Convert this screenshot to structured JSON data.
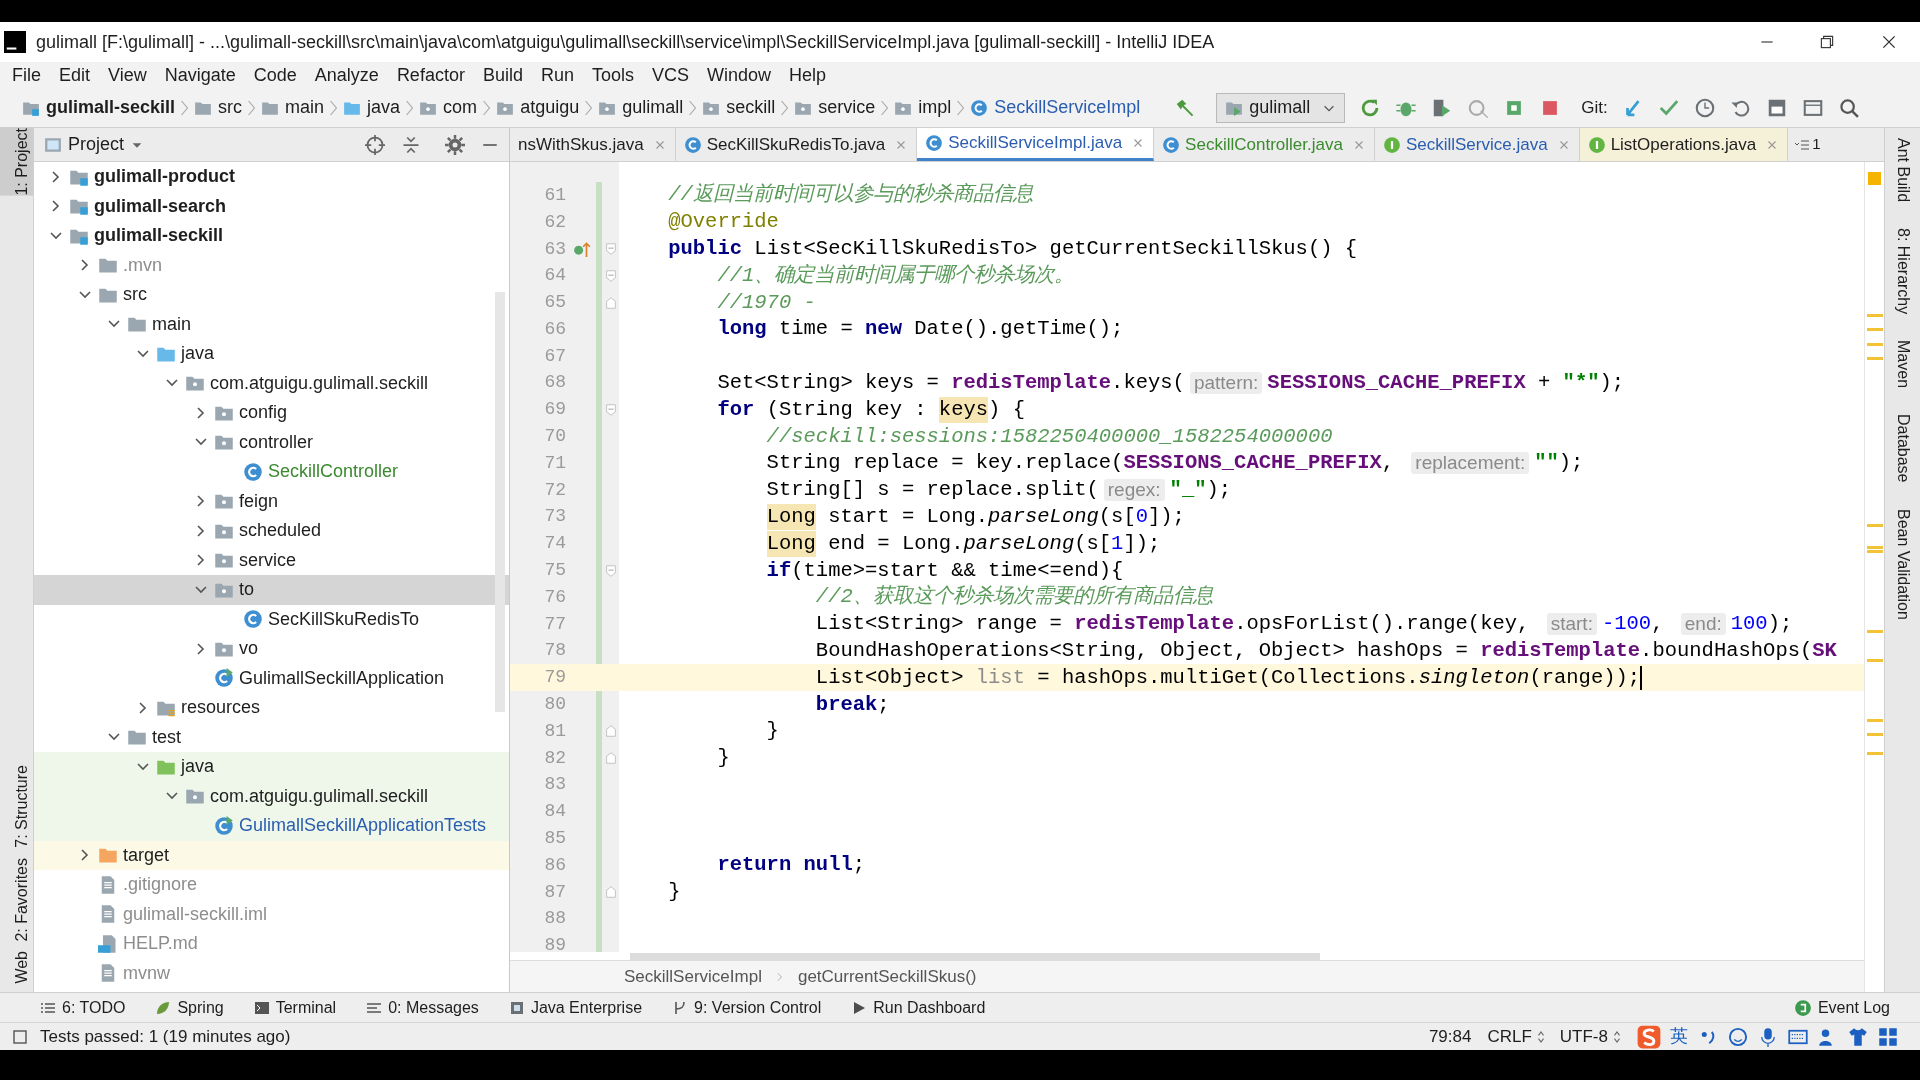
{
  "window": {
    "title": "gulimall [F:\\gulimall] - ...\\gulimall-seckill\\src\\main\\java\\com\\atguigu\\gulimall\\seckill\\service\\impl\\SeckillServiceImpl.java [gulimall-seckill] - IntelliJ IDEA"
  },
  "menu": [
    "File",
    "Edit",
    "View",
    "Navigate",
    "Code",
    "Analyze",
    "Refactor",
    "Build",
    "Run",
    "Tools",
    "VCS",
    "Window",
    "Help"
  ],
  "navigation_bar": {
    "items": [
      {
        "label": "gulimall-seckill",
        "kind": "module"
      },
      {
        "label": "src",
        "kind": "folder"
      },
      {
        "label": "main",
        "kind": "folder"
      },
      {
        "label": "java",
        "kind": "source_folder"
      },
      {
        "label": "com",
        "kind": "package"
      },
      {
        "label": "atguigu",
        "kind": "package"
      },
      {
        "label": "gulimall",
        "kind": "package"
      },
      {
        "label": "seckill",
        "kind": "package"
      },
      {
        "label": "service",
        "kind": "package"
      },
      {
        "label": "impl",
        "kind": "package"
      },
      {
        "label": "SeckillServiceImpl",
        "kind": "class"
      }
    ],
    "run_config": "gulimall",
    "vcs_label": "Git:"
  },
  "left_tool_strip": [
    {
      "label": "1: Project",
      "selected": true
    },
    {
      "label": "7: Structure",
      "selected": false
    },
    {
      "label": "2: Favorites",
      "selected": false
    },
    {
      "label": "Web",
      "selected": false
    }
  ],
  "project_panel": {
    "title": "Project",
    "tree": [
      {
        "label": "gulimall-product",
        "kind": "module",
        "expanded": false,
        "selected": false
      },
      {
        "label": "gulimall-search",
        "kind": "module",
        "expanded": false,
        "selected": false
      },
      {
        "label": "gulimall-seckill",
        "kind": "module",
        "expanded": true,
        "selected": false,
        "children": [
          {
            "label": ".mvn",
            "kind": "folder",
            "expanded": false,
            "selected": false,
            "color": "#8d8d8d"
          },
          {
            "label": "src",
            "kind": "folder",
            "expanded": true,
            "selected": false,
            "children": [
              {
                "label": "main",
                "kind": "folder",
                "expanded": true,
                "selected": false,
                "children": [
                  {
                    "label": "java",
                    "kind": "source_folder",
                    "expanded": true,
                    "selected": false,
                    "children": [
                      {
                        "label": "com.atguigu.gulimall.seckill",
                        "kind": "package",
                        "expanded": true,
                        "selected": false,
                        "children": [
                          {
                            "label": "config",
                            "kind": "package",
                            "expanded": false,
                            "selected": false
                          },
                          {
                            "label": "controller",
                            "kind": "package",
                            "expanded": true,
                            "selected": false,
                            "children": [
                              {
                                "label": "SeckillController",
                                "kind": "class",
                                "selected": false,
                                "color": "#3a8a2e"
                              }
                            ]
                          },
                          {
                            "label": "feign",
                            "kind": "package",
                            "expanded": false,
                            "selected": false
                          },
                          {
                            "label": "scheduled",
                            "kind": "package",
                            "expanded": false,
                            "selected": false
                          },
                          {
                            "label": "service",
                            "kind": "package",
                            "expanded": false,
                            "selected": false
                          },
                          {
                            "label": "to",
                            "kind": "package",
                            "expanded": true,
                            "selected": true,
                            "children": [
                              {
                                "label": "SecKillSkuRedisTo",
                                "kind": "class",
                                "selected": false
                              }
                            ]
                          },
                          {
                            "label": "vo",
                            "kind": "package",
                            "expanded": false,
                            "selected": false
                          },
                          {
                            "label": "GulimallSeckillApplication",
                            "kind": "run_class",
                            "selected": false
                          }
                        ]
                      }
                    ]
                  },
                  {
                    "label": "resources",
                    "kind": "resource_folder",
                    "expanded": false,
                    "selected": false
                  }
                ]
              },
              {
                "label": "test",
                "kind": "folder",
                "expanded": true,
                "selected": false,
                "children": [
                  {
                    "label": "java",
                    "kind": "test_folder",
                    "expanded": true,
                    "selected": false,
                    "children": [
                      {
                        "label": "com.atguigu.gulimall.seckill",
                        "kind": "package",
                        "expanded": true,
                        "selected": false,
                        "children": [
                          {
                            "label": "GulimallSeckillApplicationTests",
                            "kind": "run_class",
                            "selected": false,
                            "color": "#2a5db0"
                          }
                        ]
                      }
                    ]
                  }
                ]
              }
            ]
          },
          {
            "label": "target",
            "kind": "excluded_folder",
            "expanded": false,
            "selected": false
          },
          {
            "label": ".gitignore",
            "kind": "file",
            "selected": false,
            "color": "#8d8d8d"
          },
          {
            "label": "gulimall-seckill.iml",
            "kind": "file",
            "selected": false,
            "color": "#8d8d8d"
          },
          {
            "label": "HELP.md",
            "kind": "markdown",
            "selected": false,
            "color": "#8d8d8d"
          },
          {
            "label": "mvnw",
            "kind": "file",
            "selected": false,
            "color": "#8d8d8d"
          }
        ]
      }
    ]
  },
  "editor_tabs": [
    {
      "label": "nsWithSkus.java",
      "selected": false,
      "library": false
    },
    {
      "label": "SecKillSkuRedisTo.java",
      "selected": false,
      "library": false
    },
    {
      "label": "SeckillServiceImpl.java",
      "selected": true,
      "library": false,
      "color": "#2a5db0"
    },
    {
      "label": "SeckillController.java",
      "selected": false,
      "library": false,
      "color": "#3a8a2e"
    },
    {
      "label": "SeckillService.java",
      "selected": false,
      "library": false,
      "color": "#2a5db0"
    },
    {
      "label": "ListOperations.java",
      "selected": false,
      "library": true
    }
  ],
  "hidden_tab_count": "1",
  "editor": {
    "lines": [
      {
        "number": "61",
        "tokens": [
          {
            "kind": "comment",
            "text": "    //返回当前时间可以参与的秒杀商品信息"
          }
        ]
      },
      {
        "number": "62",
        "tokens": [
          {
            "kind": "annotation",
            "text": "    @Override"
          }
        ]
      },
      {
        "number": "63",
        "implemented": true,
        "fold_start": true,
        "tokens": [
          {
            "kind": "keyword",
            "text": "    public"
          },
          {
            "kind": "text",
            "text": " List<SecKillSkuRedisTo> getCurrentSeckillSkus() {"
          }
        ]
      },
      {
        "number": "64",
        "fold_start": true,
        "tokens": [
          {
            "kind": "comment",
            "text": "        //1、确定当前时间属于哪个秒杀场次。"
          }
        ]
      },
      {
        "number": "65",
        "fold_end": true,
        "tokens": [
          {
            "kind": "comment",
            "text": "        //1970 -"
          }
        ]
      },
      {
        "number": "66",
        "tokens": [
          {
            "kind": "keyword",
            "text": "        long"
          },
          {
            "kind": "text",
            "text": " time = "
          },
          {
            "kind": "keyword",
            "text": "new"
          },
          {
            "kind": "text",
            "text": " Date().getTime();"
          }
        ]
      },
      {
        "number": "67"
      },
      {
        "number": "68",
        "tokens": [
          {
            "kind": "text",
            "text": "        Set<String> keys = "
          },
          {
            "kind": "field",
            "text": "redisTemplate"
          },
          {
            "kind": "text",
            "text": ".keys("
          },
          {
            "kind": "hint",
            "text": "pattern:"
          },
          {
            "kind": "field",
            "text": "SESSIONS_CACHE_PREFIX"
          },
          {
            "kind": "text",
            "text": " + "
          },
          {
            "kind": "string",
            "text": "\"*\""
          },
          {
            "kind": "text",
            "text": ");"
          }
        ]
      },
      {
        "number": "69",
        "fold_start": true,
        "tokens": [
          {
            "kind": "keyword",
            "text": "        for"
          },
          {
            "kind": "text",
            "text": " (String key : "
          },
          {
            "kind": "match",
            "text": "keys"
          },
          {
            "kind": "text",
            "text": ") {"
          }
        ]
      },
      {
        "number": "70",
        "tokens": [
          {
            "kind": "comment",
            "text": "            //seckill:sessions:1582250400000_1582254000000"
          }
        ]
      },
      {
        "number": "71",
        "tokens": [
          {
            "kind": "text",
            "text": "            String replace = key.replace("
          },
          {
            "kind": "field",
            "text": "SESSIONS_CACHE_PREFIX"
          },
          {
            "kind": "text",
            "text": ", "
          },
          {
            "kind": "hint",
            "text": "replacement:"
          },
          {
            "kind": "string",
            "text": "\"\""
          },
          {
            "kind": "text",
            "text": ");"
          }
        ]
      },
      {
        "number": "72",
        "tokens": [
          {
            "kind": "text",
            "text": "            String[] s = replace.split("
          },
          {
            "kind": "hint",
            "text": "regex:"
          },
          {
            "kind": "string",
            "text": "\"_\""
          },
          {
            "kind": "text",
            "text": ");"
          }
        ]
      },
      {
        "number": "73",
        "tokens": [
          {
            "kind": "match",
            "text": "            Long"
          },
          {
            "kind": "text",
            "text": " start = Long."
          },
          {
            "kind": "static_call",
            "text": "parseLong"
          },
          {
            "kind": "text",
            "text": "(s["
          },
          {
            "kind": "number",
            "text": "0"
          },
          {
            "kind": "text",
            "text": "]);"
          }
        ]
      },
      {
        "number": "74",
        "tokens": [
          {
            "kind": "match",
            "text": "            Long"
          },
          {
            "kind": "text",
            "text": " end = Long."
          },
          {
            "kind": "static_call",
            "text": "parseLong"
          },
          {
            "kind": "text",
            "text": "(s["
          },
          {
            "kind": "number",
            "text": "1"
          },
          {
            "kind": "text",
            "text": "]);"
          }
        ]
      },
      {
        "number": "75",
        "fold_start": true,
        "tokens": [
          {
            "kind": "keyword",
            "text": "            if"
          },
          {
            "kind": "text",
            "text": "(time>=start && time<=end){"
          }
        ]
      },
      {
        "number": "76",
        "tokens": [
          {
            "kind": "comment",
            "text": "                //2、获取这个秒杀场次需要的所有商品信息"
          }
        ]
      },
      {
        "number": "77",
        "tokens": [
          {
            "kind": "text",
            "text": "                List<String> range = "
          },
          {
            "kind": "field",
            "text": "redisTemplate"
          },
          {
            "kind": "text",
            "text": ".opsForList().range(key, "
          },
          {
            "kind": "hint",
            "text": "start:"
          },
          {
            "kind": "number",
            "text": "-100"
          },
          {
            "kind": "text",
            "text": ", "
          },
          {
            "kind": "hint",
            "text": "end:"
          },
          {
            "kind": "number",
            "text": "100"
          },
          {
            "kind": "text",
            "text": ");"
          }
        ]
      },
      {
        "number": "78",
        "tokens": [
          {
            "kind": "text",
            "text": "                BoundHashOperations<String, Object, Object> hashOps = "
          },
          {
            "kind": "field",
            "text": "redisTemplate"
          },
          {
            "kind": "text",
            "text": ".boundHashOps("
          },
          {
            "kind": "field",
            "text": "SK"
          }
        ]
      },
      {
        "number": "79",
        "current": true,
        "tokens": [
          {
            "kind": "text",
            "text": "                List<Object> "
          },
          {
            "kind": "unused",
            "text": "list"
          },
          {
            "kind": "text",
            "text": " = hashOps.multiGet(Collections."
          },
          {
            "kind": "static_call",
            "text": "singleton"
          },
          {
            "kind": "text",
            "text": "(range));"
          }
        ]
      },
      {
        "number": "80",
        "tokens": [
          {
            "kind": "keyword",
            "text": "                break"
          },
          {
            "kind": "text",
            "text": ";"
          }
        ]
      },
      {
        "number": "81",
        "fold_end": true,
        "tokens": [
          {
            "kind": "text",
            "text": "            }"
          }
        ]
      },
      {
        "number": "82",
        "fold_end": true,
        "tokens": [
          {
            "kind": "text",
            "text": "        }"
          }
        ]
      },
      {
        "number": "83"
      },
      {
        "number": "84"
      },
      {
        "number": "85"
      },
      {
        "number": "86",
        "tokens": [
          {
            "kind": "keyword",
            "text": "        return"
          },
          {
            "kind": "keyword",
            "text": " null"
          },
          {
            "kind": "text",
            "text": ";"
          }
        ]
      },
      {
        "number": "87",
        "fold_end": true,
        "tokens": [
          {
            "kind": "text",
            "text": "    }"
          }
        ]
      },
      {
        "number": "88"
      },
      {
        "number": "89"
      }
    ],
    "breadcrumb": [
      "SeckillServiceImpl",
      "getCurrentSeckillSkus()"
    ]
  },
  "right_tool_strip": [
    "Ant Build",
    "8: Hierarchy",
    "Maven",
    "Database",
    "Bean Validation"
  ],
  "tool_windows": [
    "6: TODO",
    "Spring",
    "Terminal",
    "0: Messages",
    "Java Enterprise",
    "9: Version Control",
    "Run Dashboard"
  ],
  "event_log": "Event Log",
  "status_bar": {
    "message": "Tests passed: 1 (19 minutes ago)",
    "position": "79:84",
    "line_separator": "CRLF",
    "encoding": "UTF-8",
    "ime_label": "英"
  }
}
